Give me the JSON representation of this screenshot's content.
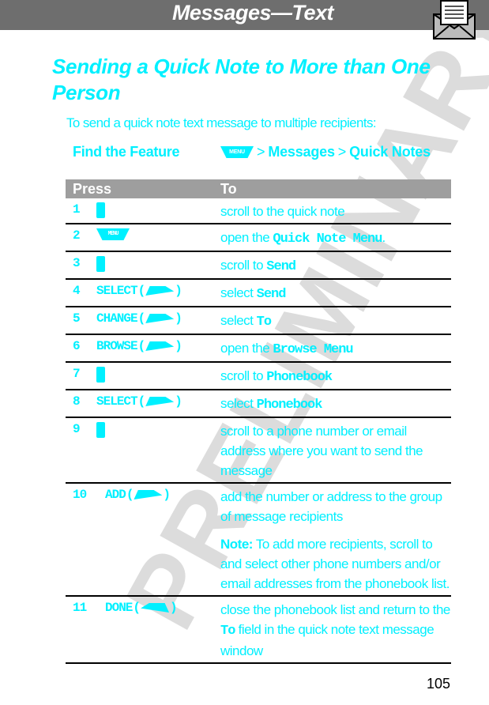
{
  "header": {
    "title": "Messages—Text",
    "icon": "envelope-letter-icon",
    "color": "#6e6e6e"
  },
  "section_title": "Sending a Quick Note to More than One Person",
  "intro": "To send a quick note text message to multiple recipients:",
  "find_feature": {
    "label": "Find the Feature",
    "menu_key": "MENU",
    "sep": ">",
    "path": [
      "Messages",
      "Quick Notes"
    ]
  },
  "table": {
    "headers": [
      "Press",
      "To"
    ],
    "rows": [
      {
        "num": "1",
        "press": "",
        "key": "nav-key",
        "to": [
          {
            "t": "scroll to the quick note"
          }
        ]
      },
      {
        "num": "2",
        "press": "",
        "key": "menu-key",
        "to": [
          {
            "t": "open the "
          },
          {
            "b": "Quick Note Menu"
          },
          {
            "t": "."
          }
        ]
      },
      {
        "num": "3",
        "press": "",
        "key": "nav-key",
        "to": [
          {
            "t": "scroll to "
          },
          {
            "b": "Send"
          }
        ]
      },
      {
        "num": "4",
        "press": "SELECT",
        "key": "right-soft-key",
        "to": [
          {
            "t": "select "
          },
          {
            "b": "Send"
          }
        ]
      },
      {
        "num": "5",
        "press": "CHANGE",
        "key": "right-soft-key",
        "to": [
          {
            "t": "select "
          },
          {
            "b": "To"
          }
        ]
      },
      {
        "num": "6",
        "press": "BROWSE",
        "key": "right-soft-key",
        "to": [
          {
            "t": "open the "
          },
          {
            "b": "Browse Menu"
          }
        ]
      },
      {
        "num": "7",
        "press": "",
        "key": "nav-key",
        "to": [
          {
            "t": "scroll to "
          },
          {
            "b": "Phonebook"
          }
        ]
      },
      {
        "num": "8",
        "press": "SELECT",
        "key": "right-soft-key",
        "to": [
          {
            "t": "select "
          },
          {
            "b": "Phonebook"
          }
        ]
      },
      {
        "num": "9",
        "press": "",
        "key": "nav-key",
        "to": [
          {
            "t": "scroll to a phone number or email address where you want to send the message"
          }
        ]
      },
      {
        "num": "10",
        "press": "ADD",
        "key": "right-soft-key",
        "to": [
          {
            "t": "add the number or address to the group of message recipients"
          }
        ],
        "note_label": "Note:",
        "note": " To add more recipients, scroll to and select other phone numbers and/or email addresses from the phonebook list."
      },
      {
        "num": "11",
        "press": "DONE",
        "key": "left-soft-key",
        "to": [
          {
            "t": "close the phonebook list and return to the "
          },
          {
            "b": "To"
          },
          {
            "t": " field in the quick note text message window"
          }
        ]
      }
    ]
  },
  "watermark": "PRELIMINARY",
  "page_number": "105",
  "colors": {
    "text": "#00f0ff",
    "table_header": "#9e9e9e",
    "watermark": "#dcdcdc"
  }
}
